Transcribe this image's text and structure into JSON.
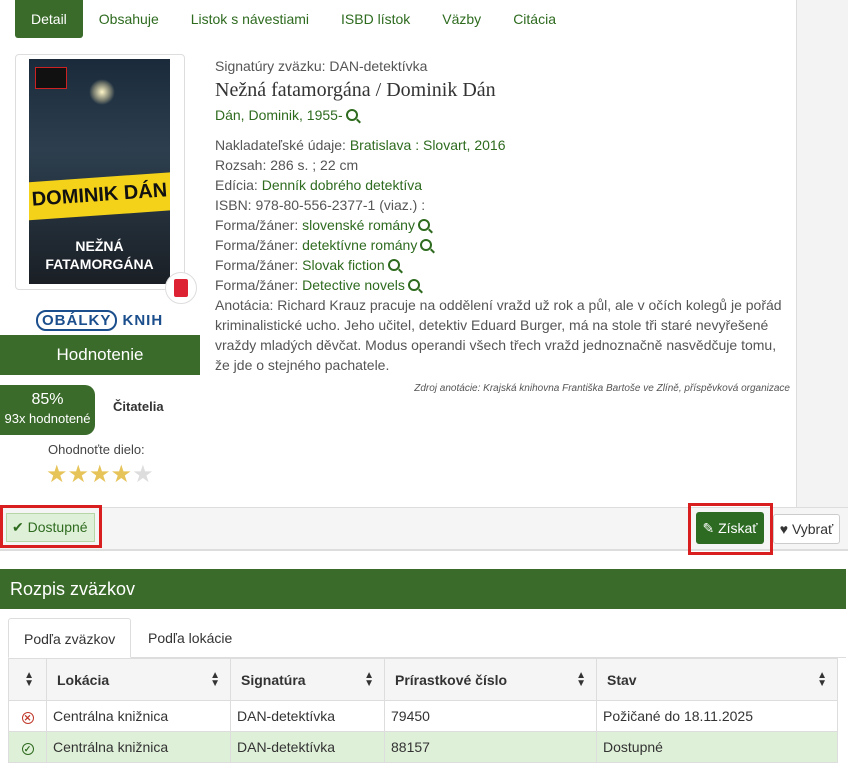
{
  "tabs": [
    {
      "label": "Detail"
    },
    {
      "label": "Obsahuje"
    },
    {
      "label": "Listok s návestiami"
    },
    {
      "label": "ISBD lístok"
    },
    {
      "label": "Väzby"
    },
    {
      "label": "Citácia"
    }
  ],
  "cover": {
    "author": "DOMINIK DÁN",
    "title_line1": "NEŽNÁ",
    "title_line2": "FATAMORGÁNA"
  },
  "obalky": {
    "text_a": "OBÁLKY",
    "text_b": "KNIH"
  },
  "rating": {
    "header": "Hodnotenie",
    "percent": "85%",
    "count": "93x hodnotené",
    "readers_label": "Čitatelia",
    "rate_prompt": "Ohodnoťte dielo:",
    "stars_filled": 4,
    "stars_total": 5
  },
  "record": {
    "signatures": "Signatúry zväzku: DAN-detektívka",
    "title": "Nežná fatamorgána / Dominik Dán",
    "author": "Dán, Dominik, 1955-",
    "publisher_label": "Nakladateľské údaje:",
    "publisher_value": "Bratislava : Slovart, 2016",
    "extent": "Rozsah: 286 s. ; 22 cm",
    "series_label": "Edícia:",
    "series_value": "Denník dobrého detektíva",
    "isbn": "ISBN: 978-80-556-2377-1 (viaz.) :",
    "genres": [
      {
        "label": "Forma/žáner:",
        "value": "slovenské romány"
      },
      {
        "label": "Forma/žáner:",
        "value": "detektívne romány"
      },
      {
        "label": "Forma/žáner:",
        "value": "Slovak fiction"
      },
      {
        "label": "Forma/žáner:",
        "value": "Detective novels"
      }
    ],
    "annotation": "Anotácia: Richard Krauz pracuje na oddělení vražd už rok a půl, ale v očích kolegů je pořád kriminalistické ucho. Jeho učitel, detektiv Eduard Burger, má na stole tři staré nevyřešené vraždy mladých děvčat. Modus operandi všech třech vražd jednoznačně nasvědčuje tomu, že jde o stejného pachatele.",
    "source": "Zdroj anotácie: Krajská knihovna Františka Bartoše ve Zlíně, příspěvková organizace"
  },
  "actions": {
    "available": "Dostupné",
    "get": "Získať",
    "pick": "Vybrať"
  },
  "volumes": {
    "header": "Rozpis zväzkov",
    "tabs": [
      "Podľa zväzkov",
      "Podľa lokácie"
    ],
    "columns": [
      "Lokácia",
      "Signatúra",
      "Prírastkové číslo",
      "Stav"
    ],
    "rows": [
      {
        "status": "borrowed",
        "location": "Centrálna knižnica",
        "signature": "DAN-detektívka",
        "accession": "79450",
        "state": "Požičané do 18.11.2025"
      },
      {
        "status": "available",
        "location": "Centrálna knižnica",
        "signature": "DAN-detektívka",
        "accession": "88157",
        "state": "Dostupné"
      }
    ]
  },
  "colors": {
    "brand_green": "#3a6b2a",
    "highlight_red": "#d81e1e",
    "available_bg": "#dff0d8"
  }
}
